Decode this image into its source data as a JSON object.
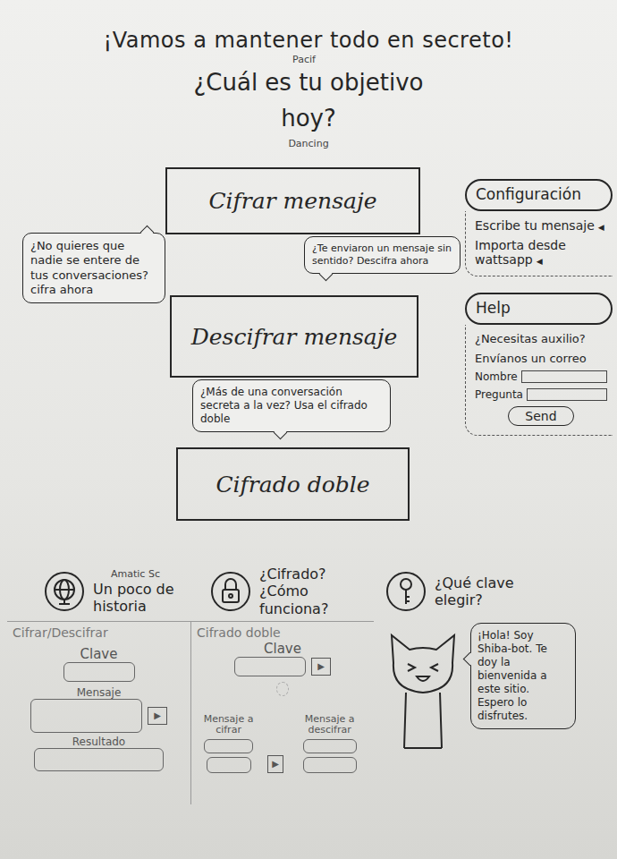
{
  "header": {
    "title": "¡Vamos a mantener todo en secreto!",
    "title_font_note": "Pacif",
    "subtitle_lines": [
      "¿Cuál es tu objetivo",
      "hoy?"
    ],
    "subtitle_font_note": "Dancing"
  },
  "actions": [
    {
      "label": "Cifrar mensaje",
      "tip": "¿No quieres que nadie se entere de tus conversaciones? cifra ahora",
      "tail": "top-right"
    },
    {
      "label": "Descifrar mensaje",
      "tip": "¿Te enviaron un mensaje sin sentido? Descifra ahora",
      "tail": "bottom-left"
    },
    {
      "label": "Cifrado doble",
      "tip": "¿Más de una conversación secreta a la vez? Usa el cifrado doble",
      "tail": "bottom"
    }
  ],
  "config": {
    "title": "Configuración",
    "items": [
      {
        "label": "Escribe tu mensaje",
        "marker": "◀"
      },
      {
        "label": "Importa desde wattsapp",
        "marker": "◀"
      }
    ]
  },
  "help": {
    "title": "Help",
    "question": "¿Necesitas auxilio?",
    "hint": "Envíanos un correo",
    "fields": [
      {
        "label": "Nombre"
      },
      {
        "label": "Pregunta"
      }
    ],
    "button": "Send"
  },
  "info_font_note": "Amatic Sc",
  "info_links": [
    {
      "label": "Un poco de historia",
      "kind": "globe"
    },
    {
      "label": "¿Cifrado? ¿Cómo funciona?",
      "kind": "lock"
    },
    {
      "label": "¿Qué clave elegir?",
      "kind": "key"
    }
  ],
  "cipher_panel": {
    "title": "Cifrar/Descifrar",
    "key_label": "Clave",
    "message_label": "Mensaje",
    "result_label": "Resultado",
    "run": "▶"
  },
  "double_panel": {
    "title": "Cifrado doble",
    "key_label": "Clave",
    "key_run": "▶",
    "left_label": "Mensaje a cifrar",
    "right_label": "Mensaje a descifrar",
    "run": "▶"
  },
  "bot": {
    "greeting": "¡Hola! Soy Shiba-bot. Te doy la bienvenida a este sitio. Espero lo disfrutes."
  }
}
